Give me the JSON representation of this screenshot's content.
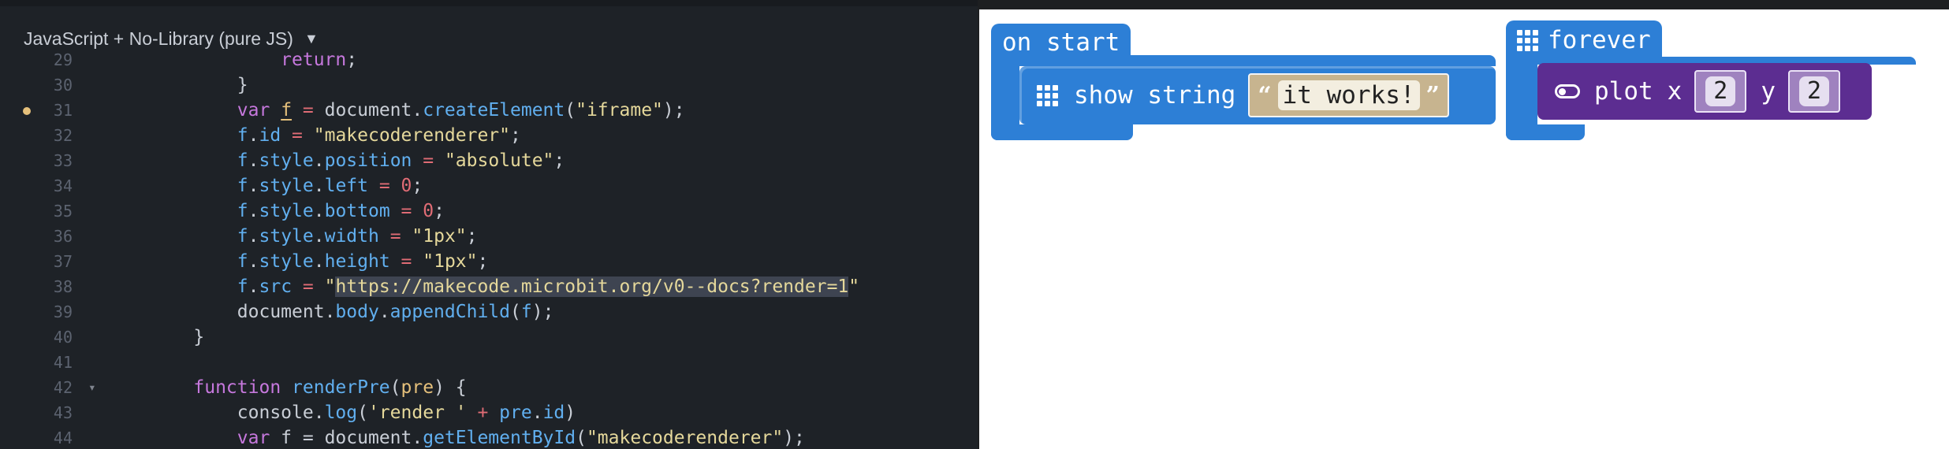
{
  "editor": {
    "language_selector": "JavaScript + No-Library (pure JS)",
    "lines": [
      {
        "num": "29",
        "tokens": [
          {
            "t": "            "
          },
          {
            "t": "return",
            "c": "t-kw"
          },
          {
            "t": ";",
            "c": "t-punc"
          }
        ]
      },
      {
        "num": "30",
        "tokens": [
          {
            "t": "        }"
          }
        ]
      },
      {
        "num": "31",
        "warn": true,
        "tokens": [
          {
            "t": "        "
          },
          {
            "t": "var",
            "c": "t-kw"
          },
          {
            "t": " "
          },
          {
            "t": "f",
            "c": "t-var t-und"
          },
          {
            "t": " = ",
            "c": "t-op"
          },
          {
            "t": "document",
            "c": "t-plain"
          },
          {
            "t": ".",
            "c": "t-punc"
          },
          {
            "t": "createElement",
            "c": "t-fn"
          },
          {
            "t": "(",
            "c": "t-punc"
          },
          {
            "t": "\"iframe\"",
            "c": "t-str"
          },
          {
            "t": ");",
            "c": "t-punc"
          }
        ]
      },
      {
        "num": "32",
        "tokens": [
          {
            "t": "        "
          },
          {
            "t": "f",
            "c": "t-prop"
          },
          {
            "t": ".",
            "c": "t-punc"
          },
          {
            "t": "id",
            "c": "t-prop"
          },
          {
            "t": " = ",
            "c": "t-op"
          },
          {
            "t": "\"makecoderenderer\"",
            "c": "t-str"
          },
          {
            "t": ";",
            "c": "t-punc"
          }
        ]
      },
      {
        "num": "33",
        "tokens": [
          {
            "t": "        "
          },
          {
            "t": "f",
            "c": "t-prop"
          },
          {
            "t": ".",
            "c": "t-punc"
          },
          {
            "t": "style",
            "c": "t-prop"
          },
          {
            "t": ".",
            "c": "t-punc"
          },
          {
            "t": "position",
            "c": "t-prop"
          },
          {
            "t": " = ",
            "c": "t-op"
          },
          {
            "t": "\"absolute\"",
            "c": "t-str"
          },
          {
            "t": ";",
            "c": "t-punc"
          }
        ]
      },
      {
        "num": "34",
        "tokens": [
          {
            "t": "        "
          },
          {
            "t": "f",
            "c": "t-prop"
          },
          {
            "t": ".",
            "c": "t-punc"
          },
          {
            "t": "style",
            "c": "t-prop"
          },
          {
            "t": ".",
            "c": "t-punc"
          },
          {
            "t": "left",
            "c": "t-prop"
          },
          {
            "t": " = ",
            "c": "t-op"
          },
          {
            "t": "0",
            "c": "t-num"
          },
          {
            "t": ";",
            "c": "t-punc"
          }
        ]
      },
      {
        "num": "35",
        "tokens": [
          {
            "t": "        "
          },
          {
            "t": "f",
            "c": "t-prop"
          },
          {
            "t": ".",
            "c": "t-punc"
          },
          {
            "t": "style",
            "c": "t-prop"
          },
          {
            "t": ".",
            "c": "t-punc"
          },
          {
            "t": "bottom",
            "c": "t-prop"
          },
          {
            "t": " = ",
            "c": "t-op"
          },
          {
            "t": "0",
            "c": "t-num"
          },
          {
            "t": ";",
            "c": "t-punc"
          }
        ]
      },
      {
        "num": "36",
        "tokens": [
          {
            "t": "        "
          },
          {
            "t": "f",
            "c": "t-prop"
          },
          {
            "t": ".",
            "c": "t-punc"
          },
          {
            "t": "style",
            "c": "t-prop"
          },
          {
            "t": ".",
            "c": "t-punc"
          },
          {
            "t": "width",
            "c": "t-prop"
          },
          {
            "t": " = ",
            "c": "t-op"
          },
          {
            "t": "\"1px\"",
            "c": "t-str"
          },
          {
            "t": ";",
            "c": "t-punc"
          }
        ]
      },
      {
        "num": "37",
        "tokens": [
          {
            "t": "        "
          },
          {
            "t": "f",
            "c": "t-prop"
          },
          {
            "t": ".",
            "c": "t-punc"
          },
          {
            "t": "style",
            "c": "t-prop"
          },
          {
            "t": ".",
            "c": "t-punc"
          },
          {
            "t": "height",
            "c": "t-prop"
          },
          {
            "t": " = ",
            "c": "t-op"
          },
          {
            "t": "\"1px\"",
            "c": "t-str"
          },
          {
            "t": ";",
            "c": "t-punc"
          }
        ]
      },
      {
        "num": "38",
        "tokens": [
          {
            "t": "        "
          },
          {
            "t": "f",
            "c": "t-prop"
          },
          {
            "t": ".",
            "c": "t-punc"
          },
          {
            "t": "src",
            "c": "t-prop"
          },
          {
            "t": " = ",
            "c": "t-op"
          },
          {
            "t": "\"",
            "c": "t-str"
          },
          {
            "t": "https://makecode.microbit.org/v0--docs?render=1",
            "c": "t-str t-hl"
          },
          {
            "t": "\"",
            "c": "t-str"
          }
        ]
      },
      {
        "num": "39",
        "tokens": [
          {
            "t": "        "
          },
          {
            "t": "document",
            "c": "t-plain"
          },
          {
            "t": ".",
            "c": "t-punc"
          },
          {
            "t": "body",
            "c": "t-prop"
          },
          {
            "t": ".",
            "c": "t-punc"
          },
          {
            "t": "appendChild",
            "c": "t-fn"
          },
          {
            "t": "(",
            "c": "t-punc"
          },
          {
            "t": "f",
            "c": "t-prop"
          },
          {
            "t": ");",
            "c": "t-punc"
          }
        ]
      },
      {
        "num": "40",
        "tokens": [
          {
            "t": "    }"
          }
        ]
      },
      {
        "num": "41",
        "tokens": [
          {
            "t": ""
          }
        ]
      },
      {
        "num": "42",
        "fold": true,
        "tokens": [
          {
            "t": "    "
          },
          {
            "t": "function",
            "c": "t-kw"
          },
          {
            "t": " "
          },
          {
            "t": "renderPre",
            "c": "t-fn"
          },
          {
            "t": "(",
            "c": "t-punc"
          },
          {
            "t": "pre",
            "c": "t-var"
          },
          {
            "t": ") {",
            "c": "t-punc"
          }
        ]
      },
      {
        "num": "43",
        "tokens": [
          {
            "t": "        "
          },
          {
            "t": "console",
            "c": "t-plain"
          },
          {
            "t": ".",
            "c": "t-punc"
          },
          {
            "t": "log",
            "c": "t-fn"
          },
          {
            "t": "(",
            "c": "t-punc"
          },
          {
            "t": "'render '",
            "c": "t-str"
          },
          {
            "t": " + ",
            "c": "t-op"
          },
          {
            "t": "pre",
            "c": "t-prop"
          },
          {
            "t": ".",
            "c": "t-punc"
          },
          {
            "t": "id",
            "c": "t-prop"
          },
          {
            "t": ")",
            "c": "t-punc"
          }
        ]
      },
      {
        "num": "44",
        "tokens": [
          {
            "t": "        "
          },
          {
            "t": "var",
            "c": "t-kw"
          },
          {
            "t": " f = ",
            "c": "t-plain"
          },
          {
            "t": "document",
            "c": "t-plain"
          },
          {
            "t": ".",
            "c": "t-punc"
          },
          {
            "t": "getElementById",
            "c": "t-fn"
          },
          {
            "t": "(",
            "c": "t-punc"
          },
          {
            "t": "\"makecoderenderer\"",
            "c": "t-str"
          },
          {
            "t": ");",
            "c": "t-punc"
          }
        ]
      }
    ]
  },
  "blocks": {
    "on_start": {
      "label": "on start",
      "show_string_label": "show string",
      "string_value": "it works!",
      "open_quote": "“",
      "close_quote": "”"
    },
    "forever": {
      "label": "forever",
      "plot_label": "plot",
      "x_label": "x",
      "x_value": "2",
      "y_label": "y",
      "y_value": "2"
    },
    "colors": {
      "basic": "#2d7fd6",
      "led": "#5c2d91",
      "text_slot": "#c7b48f",
      "num_slot": "#9f82bf"
    }
  }
}
